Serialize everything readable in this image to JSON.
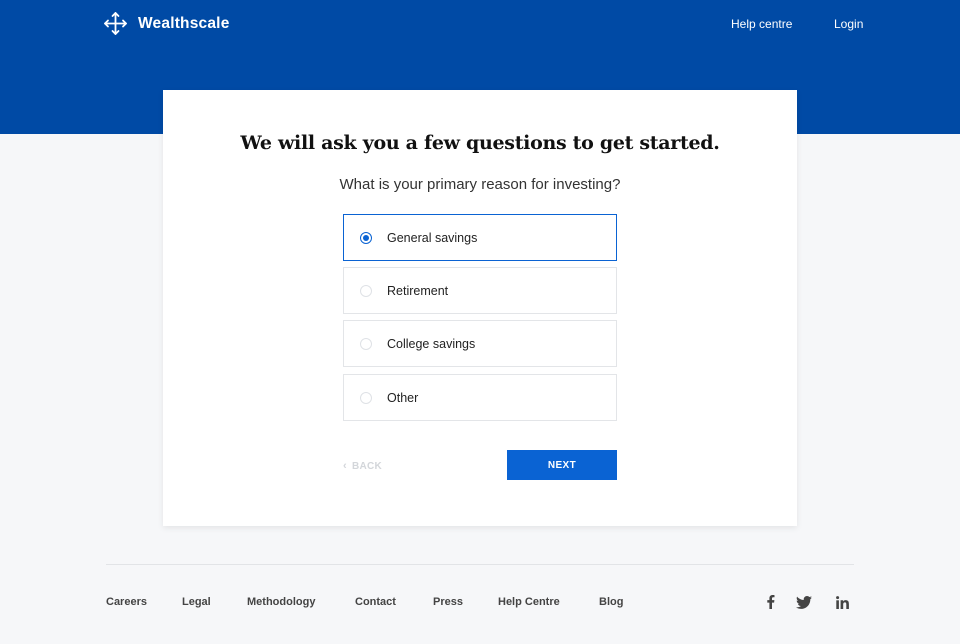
{
  "header": {
    "brand": "Wealthscale",
    "nav": {
      "help": "Help centre",
      "login": "Login"
    }
  },
  "onboarding": {
    "title": "We will ask you a few questions to get started.",
    "question": "What is your primary reason for investing?",
    "options": [
      {
        "label": "General savings",
        "selected": true
      },
      {
        "label": "Retirement",
        "selected": false
      },
      {
        "label": "College savings",
        "selected": false
      },
      {
        "label": "Other",
        "selected": false
      }
    ],
    "back_label": "BACK",
    "next_label": "NEXT"
  },
  "footer": {
    "links": [
      "Careers",
      "Legal",
      "Methodology",
      "Contact",
      "Press",
      "Help Centre",
      "Blog"
    ],
    "social": [
      "facebook-icon",
      "twitter-icon",
      "linkedin-icon"
    ]
  },
  "colors": {
    "header_bg": "#004aa5",
    "accent": "#0a63d3",
    "page_bg": "#f6f7f9"
  }
}
